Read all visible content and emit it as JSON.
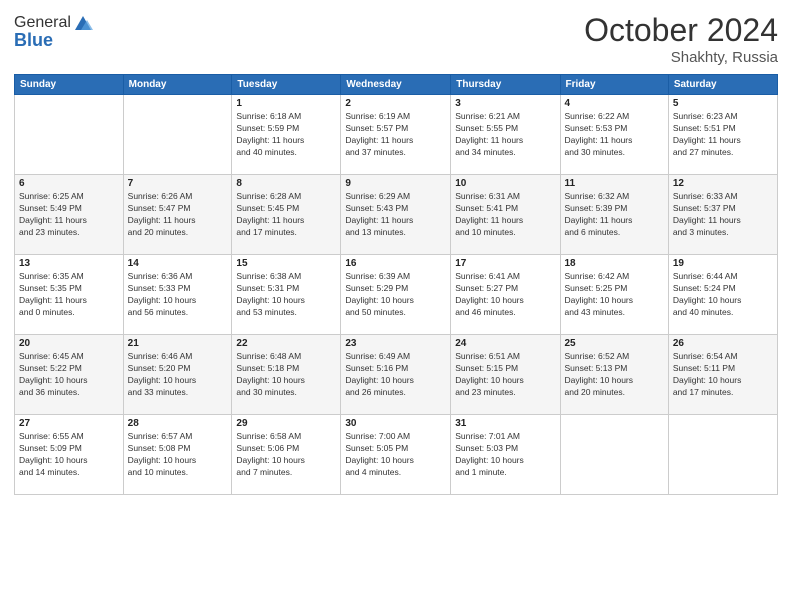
{
  "header": {
    "logo_line1": "General",
    "logo_line2": "Blue",
    "month": "October 2024",
    "location": "Shakhty, Russia"
  },
  "weekdays": [
    "Sunday",
    "Monday",
    "Tuesday",
    "Wednesday",
    "Thursday",
    "Friday",
    "Saturday"
  ],
  "weeks": [
    [
      {
        "day": "",
        "info": ""
      },
      {
        "day": "",
        "info": ""
      },
      {
        "day": "1",
        "info": "Sunrise: 6:18 AM\nSunset: 5:59 PM\nDaylight: 11 hours\nand 40 minutes."
      },
      {
        "day": "2",
        "info": "Sunrise: 6:19 AM\nSunset: 5:57 PM\nDaylight: 11 hours\nand 37 minutes."
      },
      {
        "day": "3",
        "info": "Sunrise: 6:21 AM\nSunset: 5:55 PM\nDaylight: 11 hours\nand 34 minutes."
      },
      {
        "day": "4",
        "info": "Sunrise: 6:22 AM\nSunset: 5:53 PM\nDaylight: 11 hours\nand 30 minutes."
      },
      {
        "day": "5",
        "info": "Sunrise: 6:23 AM\nSunset: 5:51 PM\nDaylight: 11 hours\nand 27 minutes."
      }
    ],
    [
      {
        "day": "6",
        "info": "Sunrise: 6:25 AM\nSunset: 5:49 PM\nDaylight: 11 hours\nand 23 minutes."
      },
      {
        "day": "7",
        "info": "Sunrise: 6:26 AM\nSunset: 5:47 PM\nDaylight: 11 hours\nand 20 minutes."
      },
      {
        "day": "8",
        "info": "Sunrise: 6:28 AM\nSunset: 5:45 PM\nDaylight: 11 hours\nand 17 minutes."
      },
      {
        "day": "9",
        "info": "Sunrise: 6:29 AM\nSunset: 5:43 PM\nDaylight: 11 hours\nand 13 minutes."
      },
      {
        "day": "10",
        "info": "Sunrise: 6:31 AM\nSunset: 5:41 PM\nDaylight: 11 hours\nand 10 minutes."
      },
      {
        "day": "11",
        "info": "Sunrise: 6:32 AM\nSunset: 5:39 PM\nDaylight: 11 hours\nand 6 minutes."
      },
      {
        "day": "12",
        "info": "Sunrise: 6:33 AM\nSunset: 5:37 PM\nDaylight: 11 hours\nand 3 minutes."
      }
    ],
    [
      {
        "day": "13",
        "info": "Sunrise: 6:35 AM\nSunset: 5:35 PM\nDaylight: 11 hours\nand 0 minutes."
      },
      {
        "day": "14",
        "info": "Sunrise: 6:36 AM\nSunset: 5:33 PM\nDaylight: 10 hours\nand 56 minutes."
      },
      {
        "day": "15",
        "info": "Sunrise: 6:38 AM\nSunset: 5:31 PM\nDaylight: 10 hours\nand 53 minutes."
      },
      {
        "day": "16",
        "info": "Sunrise: 6:39 AM\nSunset: 5:29 PM\nDaylight: 10 hours\nand 50 minutes."
      },
      {
        "day": "17",
        "info": "Sunrise: 6:41 AM\nSunset: 5:27 PM\nDaylight: 10 hours\nand 46 minutes."
      },
      {
        "day": "18",
        "info": "Sunrise: 6:42 AM\nSunset: 5:25 PM\nDaylight: 10 hours\nand 43 minutes."
      },
      {
        "day": "19",
        "info": "Sunrise: 6:44 AM\nSunset: 5:24 PM\nDaylight: 10 hours\nand 40 minutes."
      }
    ],
    [
      {
        "day": "20",
        "info": "Sunrise: 6:45 AM\nSunset: 5:22 PM\nDaylight: 10 hours\nand 36 minutes."
      },
      {
        "day": "21",
        "info": "Sunrise: 6:46 AM\nSunset: 5:20 PM\nDaylight: 10 hours\nand 33 minutes."
      },
      {
        "day": "22",
        "info": "Sunrise: 6:48 AM\nSunset: 5:18 PM\nDaylight: 10 hours\nand 30 minutes."
      },
      {
        "day": "23",
        "info": "Sunrise: 6:49 AM\nSunset: 5:16 PM\nDaylight: 10 hours\nand 26 minutes."
      },
      {
        "day": "24",
        "info": "Sunrise: 6:51 AM\nSunset: 5:15 PM\nDaylight: 10 hours\nand 23 minutes."
      },
      {
        "day": "25",
        "info": "Sunrise: 6:52 AM\nSunset: 5:13 PM\nDaylight: 10 hours\nand 20 minutes."
      },
      {
        "day": "26",
        "info": "Sunrise: 6:54 AM\nSunset: 5:11 PM\nDaylight: 10 hours\nand 17 minutes."
      }
    ],
    [
      {
        "day": "27",
        "info": "Sunrise: 6:55 AM\nSunset: 5:09 PM\nDaylight: 10 hours\nand 14 minutes."
      },
      {
        "day": "28",
        "info": "Sunrise: 6:57 AM\nSunset: 5:08 PM\nDaylight: 10 hours\nand 10 minutes."
      },
      {
        "day": "29",
        "info": "Sunrise: 6:58 AM\nSunset: 5:06 PM\nDaylight: 10 hours\nand 7 minutes."
      },
      {
        "day": "30",
        "info": "Sunrise: 7:00 AM\nSunset: 5:05 PM\nDaylight: 10 hours\nand 4 minutes."
      },
      {
        "day": "31",
        "info": "Sunrise: 7:01 AM\nSunset: 5:03 PM\nDaylight: 10 hours\nand 1 minute."
      },
      {
        "day": "",
        "info": ""
      },
      {
        "day": "",
        "info": ""
      }
    ]
  ]
}
